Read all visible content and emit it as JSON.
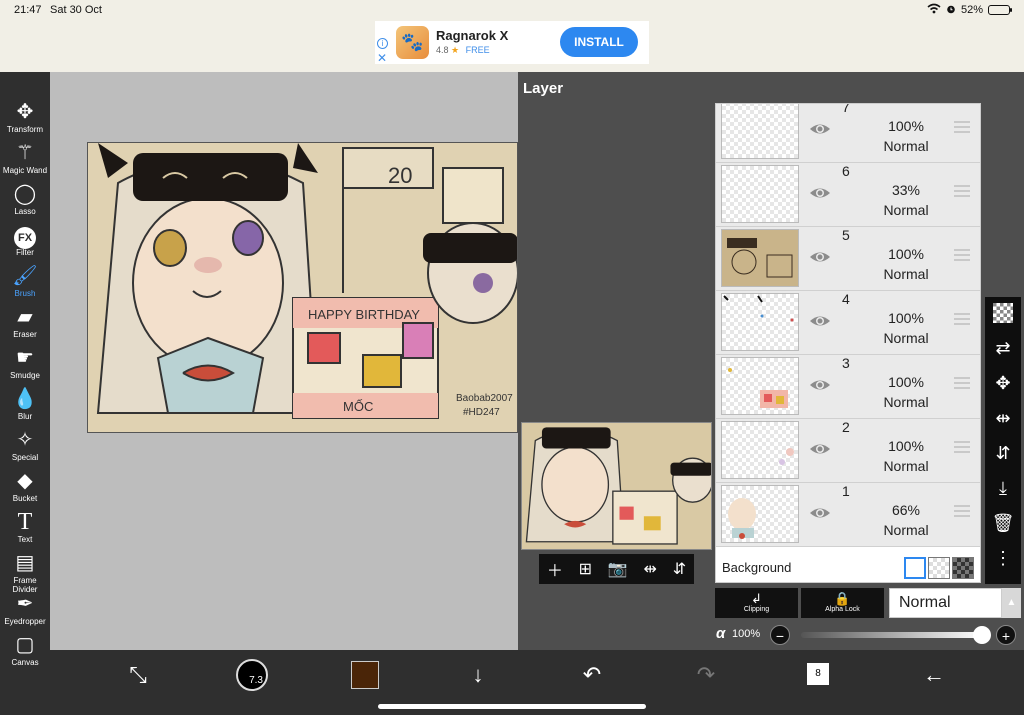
{
  "status": {
    "time": "21:47",
    "date": "Sat 30 Oct",
    "battery": "52%",
    "battery_level": 0.52
  },
  "ad": {
    "app_name": "Ragnarok X",
    "rating": "4.8",
    "price": "FREE",
    "cta": "INSTALL"
  },
  "toolbar": {
    "tools": [
      {
        "label": "Transform"
      },
      {
        "label": "Magic Wand"
      },
      {
        "label": "Lasso"
      },
      {
        "label": "Filter"
      },
      {
        "label": "Brush"
      },
      {
        "label": "Eraser"
      },
      {
        "label": "Smudge"
      },
      {
        "label": "Blur"
      },
      {
        "label": "Special"
      },
      {
        "label": "Bucket"
      },
      {
        "label": "Text"
      },
      {
        "label": "Frame Divider"
      },
      {
        "label": "Eyedropper"
      },
      {
        "label": "Canvas"
      }
    ],
    "active": "Brush"
  },
  "layer_panel": {
    "title": "Layer",
    "layers": [
      {
        "number": "7",
        "opacity": "100%",
        "mode": "Normal"
      },
      {
        "number": "6",
        "opacity": "33%",
        "mode": "Normal"
      },
      {
        "number": "5",
        "opacity": "100%",
        "mode": "Normal"
      },
      {
        "number": "4",
        "opacity": "100%",
        "mode": "Normal"
      },
      {
        "number": "3",
        "opacity": "100%",
        "mode": "Normal"
      },
      {
        "number": "2",
        "opacity": "100%",
        "mode": "Normal"
      },
      {
        "number": "1",
        "opacity": "66%",
        "mode": "Normal"
      }
    ],
    "background_label": "Background",
    "clipping_label": "Clipping",
    "alpha_lock_label": "Alpha Lock",
    "blend_mode": "Normal",
    "alpha_symbol": "α",
    "alpha_value": "100%",
    "alpha_level": 1.0
  },
  "bottombar": {
    "brush_size": "7.3",
    "color": "#4a2508",
    "layers_count": "8"
  }
}
